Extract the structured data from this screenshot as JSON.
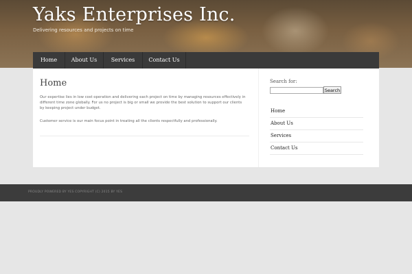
{
  "header": {
    "site_title": "Yaks Enterprises Inc.",
    "tagline": "Delivering resources and projects on time"
  },
  "nav": {
    "items": [
      {
        "label": "Home"
      },
      {
        "label": "About Us"
      },
      {
        "label": "Services"
      },
      {
        "label": "Contact Us"
      }
    ]
  },
  "main": {
    "title": "Home",
    "paragraphs": [
      "Our expertise lies in low cost operation and delivering each project on time by managing resources effectively in different time zone globally.  For us no project is big or small we provide the best solution to support our clients by keeping project under budget.",
      "Customer service is our main focus point in treating all the clients respectfully and professionally."
    ]
  },
  "sidebar": {
    "search_label": "Search for:",
    "search_value": "",
    "search_button": "Search",
    "links": [
      {
        "label": "Home"
      },
      {
        "label": "About Us"
      },
      {
        "label": "Services"
      },
      {
        "label": "Contact Us"
      }
    ]
  },
  "footer": {
    "text": "PROUDLY POWERED BY YES   COPYRIGHT (C) 2015 BY YES"
  }
}
